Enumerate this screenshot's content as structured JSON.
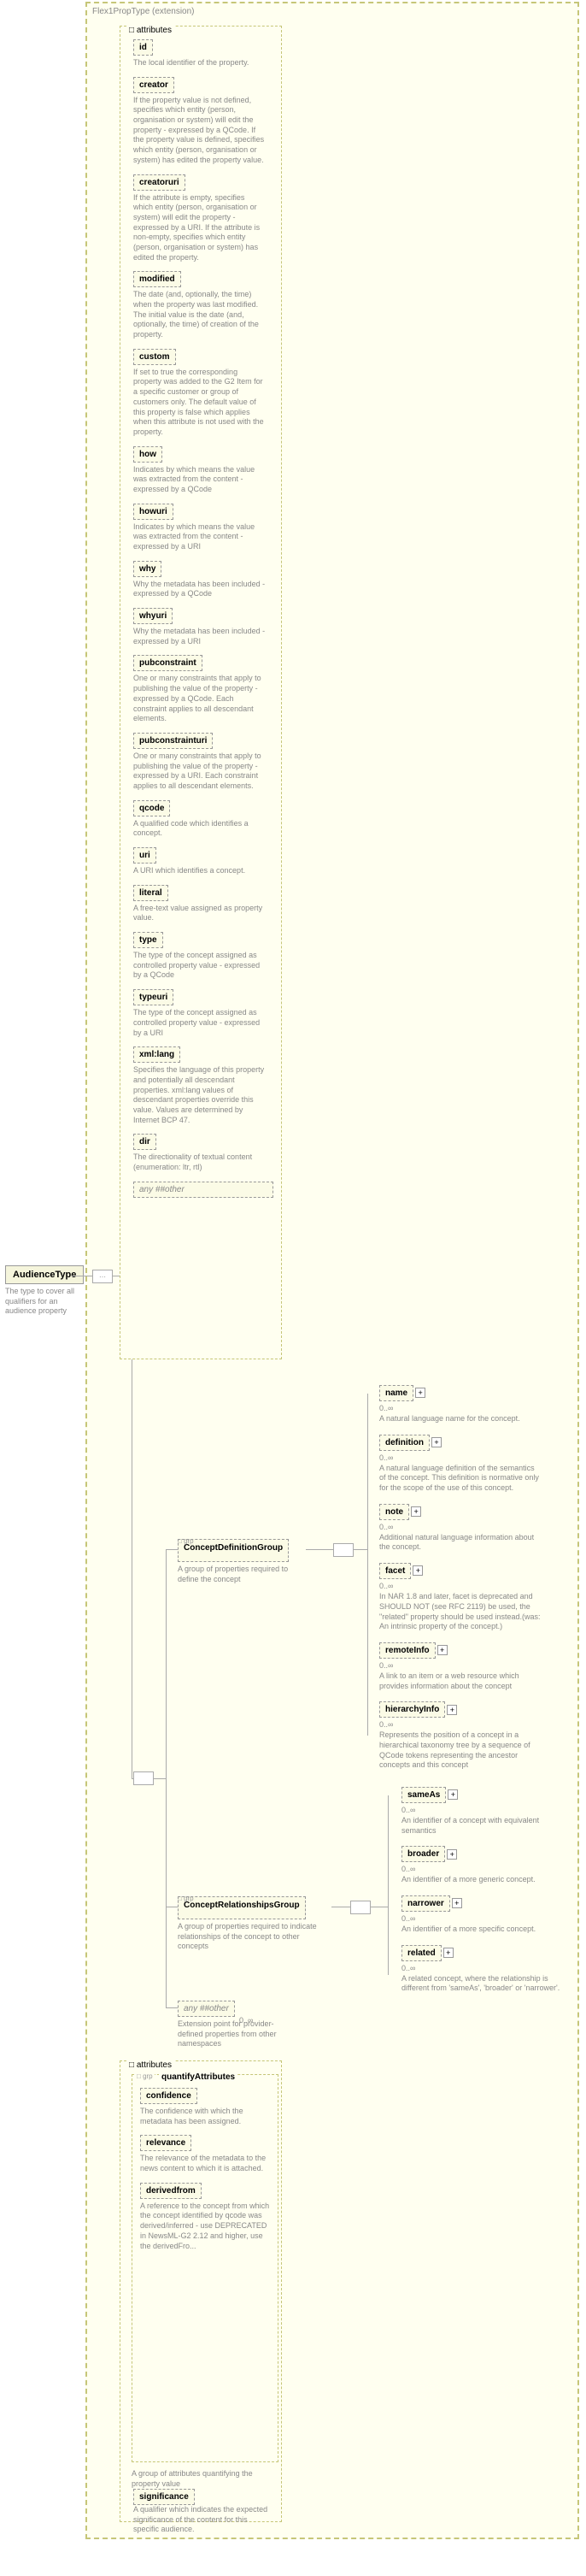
{
  "root": {
    "name": "AudienceType",
    "desc": "The type to cover all qualifiers for an audience property"
  },
  "extLabel": "Flex1PropType (extension)",
  "attrHeader": "attributes",
  "any": {
    "label": "any ##other",
    "cnt": "0..∞",
    "desc2": "Extension point for provider-defined properties from other namespaces"
  },
  "attrs": [
    {
      "name": "id",
      "desc": "The local identifier of the property."
    },
    {
      "name": "creator",
      "desc": "If the property value is not defined, specifies which entity (person, organisation or system) will edit the property - expressed by a QCode. If the property value is defined, specifies which entity (person, organisation or system) has edited the property value."
    },
    {
      "name": "creatoruri",
      "desc": "If the attribute is empty, specifies which entity (person, organisation or system) will edit the property - expressed by a URI. If the attribute is non-empty, specifies which entity (person, organisation or system) has edited the property."
    },
    {
      "name": "modified",
      "desc": "The date (and, optionally, the time) when the property was last modified. The initial value is the date (and, optionally, the time) of creation of the property."
    },
    {
      "name": "custom",
      "desc": "If set to true the corresponding property was added to the G2 Item for a specific customer or group of customers only. The default value of this property is false which applies when this attribute is not used with the property."
    },
    {
      "name": "how",
      "desc": "Indicates by which means the value was extracted from the content - expressed by a QCode"
    },
    {
      "name": "howuri",
      "desc": "Indicates by which means the value was extracted from the content - expressed by a URI"
    },
    {
      "name": "why",
      "desc": "Why the metadata has been included - expressed by a QCode"
    },
    {
      "name": "whyuri",
      "desc": "Why the metadata has been included - expressed by a URI"
    },
    {
      "name": "pubconstraint",
      "desc": "One or many constraints that apply to publishing the value of the property - expressed by a QCode. Each constraint applies to all descendant elements."
    },
    {
      "name": "pubconstrainturi",
      "desc": "One or many constraints that apply to publishing the value of the property - expressed by a URI. Each constraint applies to all descendant elements."
    },
    {
      "name": "qcode",
      "desc": "A qualified code which identifies a concept."
    },
    {
      "name": "uri",
      "desc": "A URI which identifies a concept."
    },
    {
      "name": "literal",
      "desc": "A free-text value assigned as property value."
    },
    {
      "name": "type",
      "desc": "The type of the concept assigned as controlled property value - expressed by a QCode"
    },
    {
      "name": "typeuri",
      "desc": "The type of the concept assigned as controlled property value - expressed by a URI"
    },
    {
      "name": "xml:lang",
      "desc": "Specifies the language of this property and potentially all descendant properties. xml:lang values of descendant properties override this value. Values are determined by Internet BCP 47."
    },
    {
      "name": "dir",
      "desc": "The directionality of textual content (enumeration: ltr, rtl)"
    }
  ],
  "cdg": {
    "badge": "grp",
    "name": "ConceptDefinitionGroup",
    "desc": "A group of properties required to define the concept"
  },
  "cdgItems": [
    {
      "name": "name",
      "cnt": "0..∞",
      "desc": "A natural language name for the concept."
    },
    {
      "name": "definition",
      "cnt": "0..∞",
      "desc": "A natural language definition of the semantics of the concept. This definition is normative only for the scope of the use of this concept."
    },
    {
      "name": "note",
      "cnt": "0..∞",
      "desc": "Additional natural language information about the concept."
    },
    {
      "name": "facet",
      "cnt": "0..∞",
      "desc": "In NAR 1.8 and later, facet is deprecated and SHOULD NOT (see RFC 2119) be used, the \"related\" property should be used instead.(was: An intrinsic property of the concept.)"
    },
    {
      "name": "remoteInfo",
      "cnt": "0..∞",
      "desc": "A link to an item or a web resource which provides information about the concept"
    },
    {
      "name": "hierarchyInfo",
      "cnt": "0..∞",
      "desc": "Represents the position of a concept in a hierarchical taxonomy tree by a sequence of QCode tokens representing the ancestor concepts and this concept"
    }
  ],
  "crg": {
    "badge": "grp",
    "name": "ConceptRelationshipsGroup",
    "desc": "A group of properties required to indicate relationships of the concept to other concepts"
  },
  "crgItems": [
    {
      "name": "sameAs",
      "cnt": "0..∞",
      "desc": "An identifier of a concept with equivalent semantics"
    },
    {
      "name": "broader",
      "cnt": "0..∞",
      "desc": "An identifier of a more generic concept."
    },
    {
      "name": "narrower",
      "cnt": "0..∞",
      "desc": "An identifier of a more specific concept."
    },
    {
      "name": "related",
      "cnt": "0..∞",
      "desc": "A related concept, where the relationship is different from 'sameAs', 'broader' or 'narrower'."
    }
  ],
  "qa": {
    "badge": "grp",
    "name": "quantifyAttributes",
    "desc": "A group of attributes quantifying the property value"
  },
  "qaItems": [
    {
      "name": "confidence",
      "desc": "The confidence with which the metadata has been assigned."
    },
    {
      "name": "relevance",
      "desc": "The relevance of the metadata to the news content to which it is attached."
    },
    {
      "name": "derivedfrom",
      "desc": "A reference to the concept from which the concept identified by qcode was derived/inferred - use DEPRECATED in NewsML-G2 2.12 and higher, use the derivedFro..."
    }
  ],
  "sig": {
    "name": "significance",
    "desc": "A qualifier which indicates the expected significance of the content for this specific audience."
  }
}
